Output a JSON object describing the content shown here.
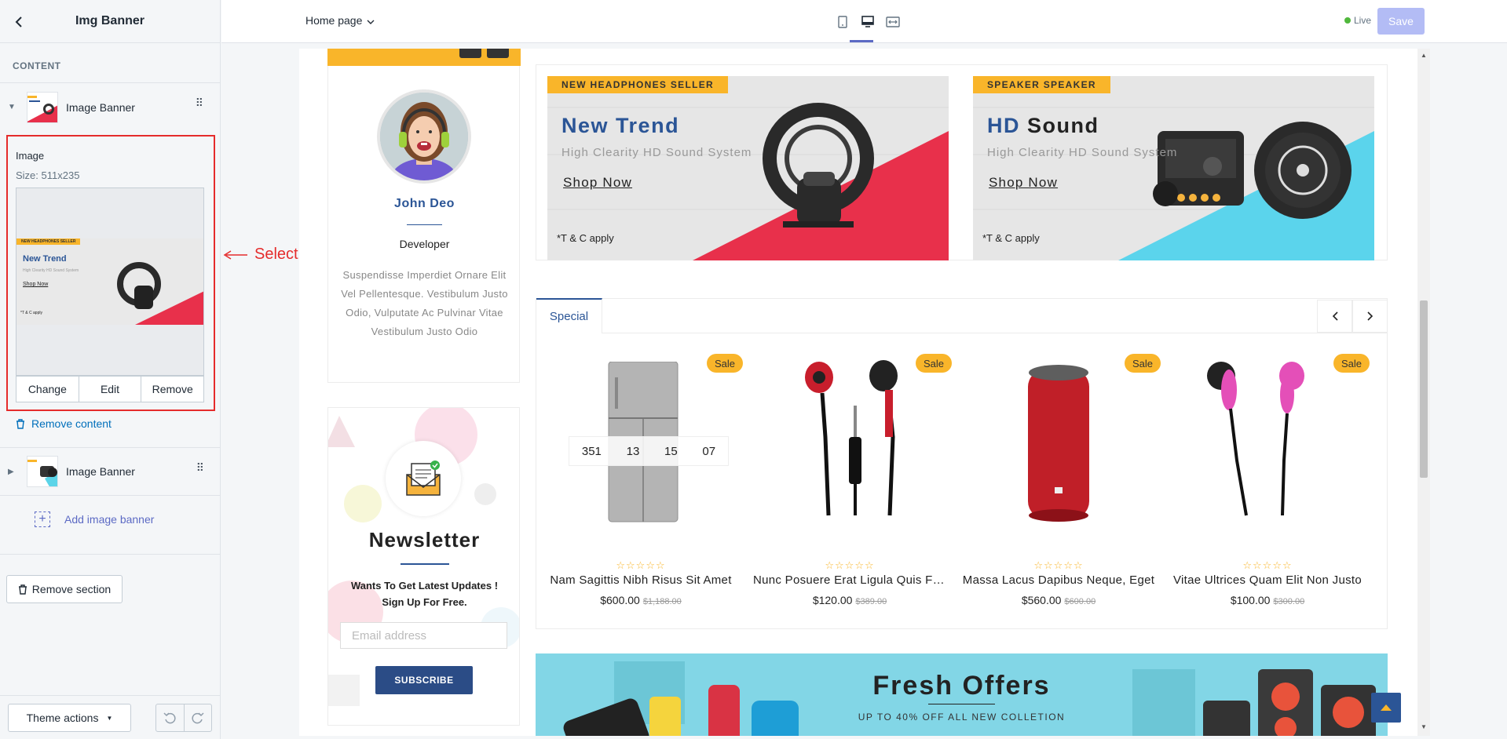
{
  "sidebar": {
    "title": "Img Banner",
    "section_label": "CONTENT",
    "blocks": [
      {
        "label": "Image Banner",
        "expanded": true
      },
      {
        "label": "Image Banner",
        "expanded": false
      }
    ],
    "image_setting": {
      "label": "Image",
      "size": "Size: 511x235",
      "actions": [
        "Change",
        "Edit",
        "Remove"
      ]
    },
    "remove_content": "Remove content",
    "add_image_banner": "Add image banner",
    "remove_section": "Remove section",
    "theme_actions": "Theme actions"
  },
  "annotation": "Select Banner for Imgbanner",
  "topbar": {
    "page": "Home page",
    "live_label": "Live",
    "save_label": "Save"
  },
  "profile": {
    "name": "John Deo",
    "role": "Developer",
    "description": "Suspendisse Imperdiet Ornare Elit Vel Pellentesque. Vestibulum Justo Odio, Vulputate Ac Pulvinar Vitae Vestibulum Justo Odio"
  },
  "newsletter": {
    "title": "Newsletter",
    "text_line1": "Wants To Get Latest Updates !",
    "text_line2": "Sign Up For Free.",
    "placeholder": "Email address",
    "button": "SUBSCRIBE"
  },
  "banners": [
    {
      "tag": "NEW HEADPHONES SELLER",
      "title_a": "New",
      "title_b": "Trend",
      "subtitle": "High Clearity HD Sound System",
      "cta": "Shop Now",
      "tc": "*T & C apply"
    },
    {
      "tag": "SPEAKER SPEAKER",
      "title_a": "HD",
      "title_b": "Sound",
      "subtitle": "High Clearity HD Sound System",
      "cta": "Shop Now",
      "tc": "*T & C apply"
    }
  ],
  "preview_banner": {
    "tag": "NEW HEADPHONES SELLER",
    "title": "New Trend",
    "subtitle": "High Clearity HD Sound System",
    "cta": "Shop Now",
    "tc": "*T & C apply"
  },
  "special": {
    "tab": "Special",
    "sale_label": "Sale",
    "stars": "☆☆☆☆☆",
    "countdown": [
      "351",
      "13",
      "15",
      "07"
    ],
    "products": [
      {
        "name": "Nam Sagittis Nibh Risus Sit Amet",
        "price": "$600.00",
        "old_price": "$1,188.00"
      },
      {
        "name": "Nunc Posuere Erat Ligula Quis Felis",
        "price": "$120.00",
        "old_price": "$389.00"
      },
      {
        "name": "Massa Lacus Dapibus Neque, Eget",
        "price": "$560.00",
        "old_price": "$600.00"
      },
      {
        "name": "Vitae Ultrices Quam Elit Non Justo",
        "price": "$100.00",
        "old_price": "$300.00"
      }
    ]
  },
  "fresh": {
    "title": "Fresh Offers",
    "subtitle": "UP TO 40% OFF ALL NEW COLLETION"
  },
  "colors": {
    "accent": "#5c6ac4",
    "brand_blue": "#2b5596",
    "sale_yellow": "#f9b52a",
    "annotation_red": "#e52c2c"
  }
}
